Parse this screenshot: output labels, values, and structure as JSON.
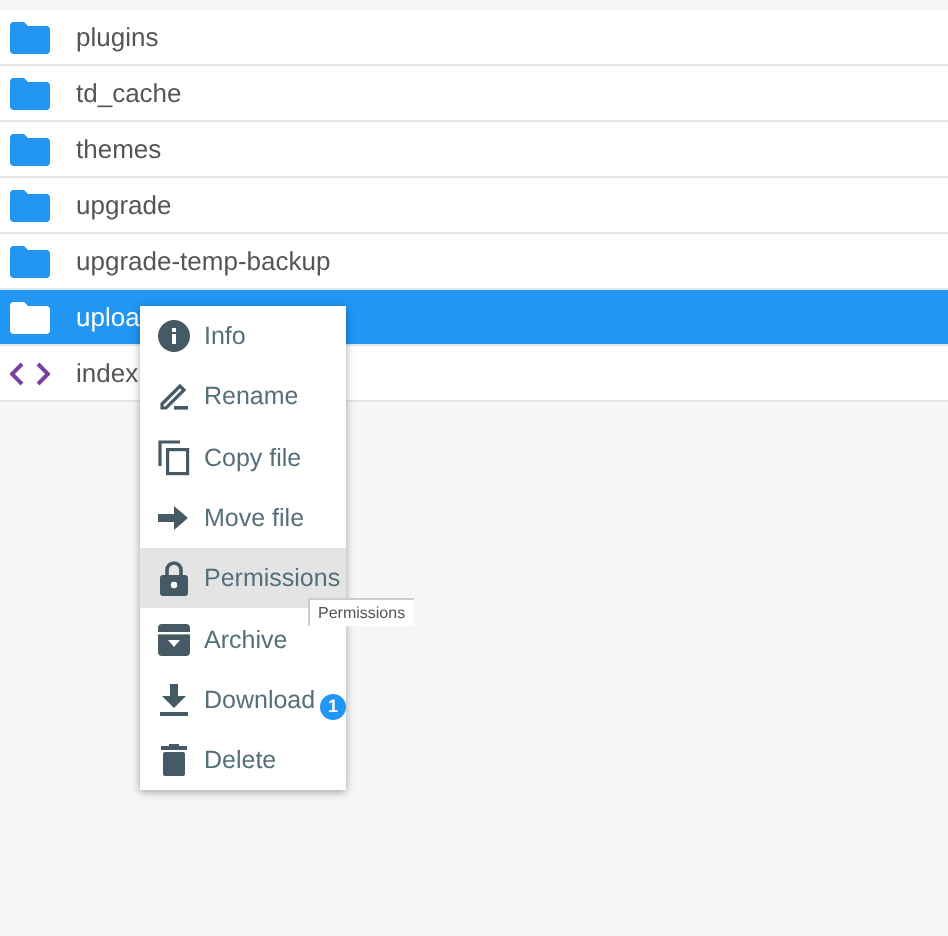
{
  "files": [
    {
      "name": "plugins",
      "kind": "folder",
      "selected": false
    },
    {
      "name": "td_cache",
      "kind": "folder",
      "selected": false
    },
    {
      "name": "themes",
      "kind": "folder",
      "selected": false
    },
    {
      "name": "upgrade",
      "kind": "folder",
      "selected": false
    },
    {
      "name": "upgrade-temp-backup",
      "kind": "folder",
      "selected": false
    },
    {
      "name": "uploa",
      "kind": "folder",
      "selected": true
    },
    {
      "name": "index",
      "kind": "code",
      "selected": false
    }
  ],
  "context_menu": {
    "items": [
      {
        "label": "Info",
        "kind": "info",
        "selected": false
      },
      {
        "label": "Rename",
        "kind": "rename",
        "selected": false
      },
      {
        "label": "Copy file",
        "kind": "copy",
        "selected": false
      },
      {
        "label": "Move file",
        "kind": "move",
        "selected": false
      },
      {
        "label": "Permissions",
        "kind": "permissions",
        "selected": true
      },
      {
        "label": "Archive",
        "kind": "archive",
        "selected": false
      },
      {
        "label": "Download",
        "kind": "download",
        "selected": false,
        "badge": "1"
      },
      {
        "label": "Delete",
        "kind": "delete",
        "selected": false
      }
    ]
  },
  "tooltip": "Permissions"
}
